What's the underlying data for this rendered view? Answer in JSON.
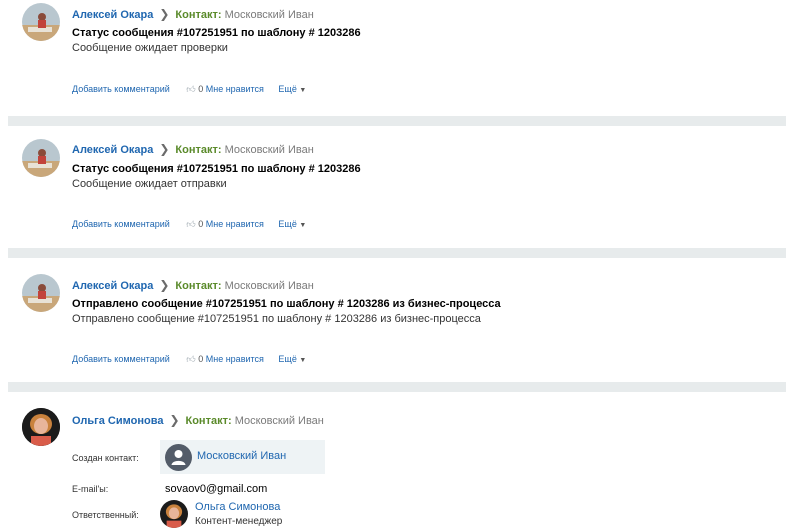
{
  "feed": {
    "posts": [
      {
        "author": "Алексей Окара",
        "contact_label": "Контакт:",
        "contact_name": "Московский Иван",
        "title": "Статус сообщения #107251951 по шаблону # 1203286",
        "description": "Сообщение ожидает проверки",
        "comment_label": "Добавить комментарий",
        "like_count": "0",
        "like_label": "Мне нравится",
        "more_label": "Ещё"
      },
      {
        "author": "Алексей Окара",
        "contact_label": "Контакт:",
        "contact_name": "Московский Иван",
        "title": "Статус сообщения #107251951 по шаблону # 1203286",
        "description": "Сообщение ожидает отправки",
        "comment_label": "Добавить комментарий",
        "like_count": "0",
        "like_label": "Мне нравится",
        "more_label": "Ещё"
      },
      {
        "author": "Алексей Окара",
        "contact_label": "Контакт:",
        "contact_name": "Московский Иван",
        "title": "Отправлено сообщение #107251951 по шаблону # 1203286 из бизнес-процесса",
        "description": "Отправлено сообщение #107251951 по шаблону # 1203286 из бизнес-процесса",
        "comment_label": "Добавить комментарий",
        "like_count": "0",
        "like_label": "Мне нравится",
        "more_label": "Ещё"
      }
    ],
    "contact_post": {
      "author": "Ольга Симонова",
      "contact_label": "Контакт:",
      "contact_name": "Московский Иван",
      "created_label": "Создан контакт:",
      "created_contact_name": "Московский Иван",
      "email_label": "E-mail'ы:",
      "email_value": "sovaov0@gmail.com",
      "responsible_label": "Ответственный:",
      "responsible_name": "Ольга Симонова",
      "responsible_role": "Контент-менеджер"
    }
  },
  "icons": {
    "arrow": "chevron-right-icon",
    "like": "thumbs-up-icon",
    "more": "caret-down-icon",
    "contact": "person-icon"
  },
  "colors": {
    "link": "#2067b0",
    "contact_label": "#5a8a2a",
    "separator": "#e7ebec",
    "contact_card_bg": "#eef3f5",
    "contact_icon_bg": "#535c69"
  }
}
